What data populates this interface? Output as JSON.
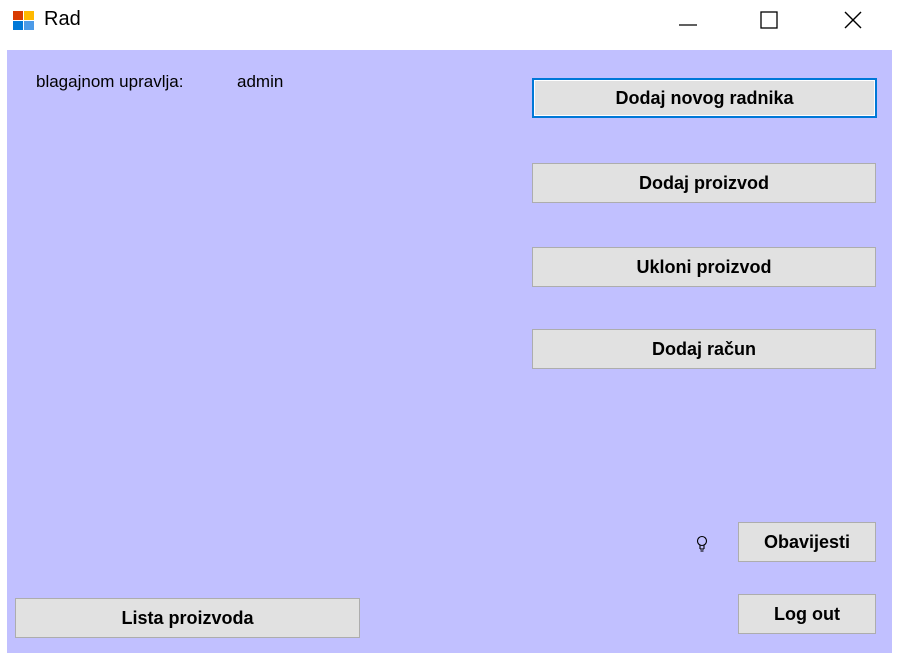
{
  "window": {
    "title": "Rad",
    "icon": "windows-form-icon",
    "controls": [
      "minimize-icon",
      "maximize-icon",
      "close-icon"
    ]
  },
  "header": {
    "operator_label": "blagajnom upravlja:",
    "operator_value": "admin"
  },
  "actions": {
    "add_employee": "Dodaj novog radnika",
    "add_product": "Dodaj proizvod",
    "remove_product": "Ukloni proizvod",
    "add_receipt": "Dodaj račun"
  },
  "footer": {
    "notification_icon": "lightbulb-icon",
    "notifications": "Obavijesti",
    "product_list": "Lista proizvoda",
    "logout": "Log out"
  },
  "colors": {
    "client_background": "#c1c0ff",
    "button_face": "#e1e1e1",
    "focus_border": "#0078d7"
  }
}
